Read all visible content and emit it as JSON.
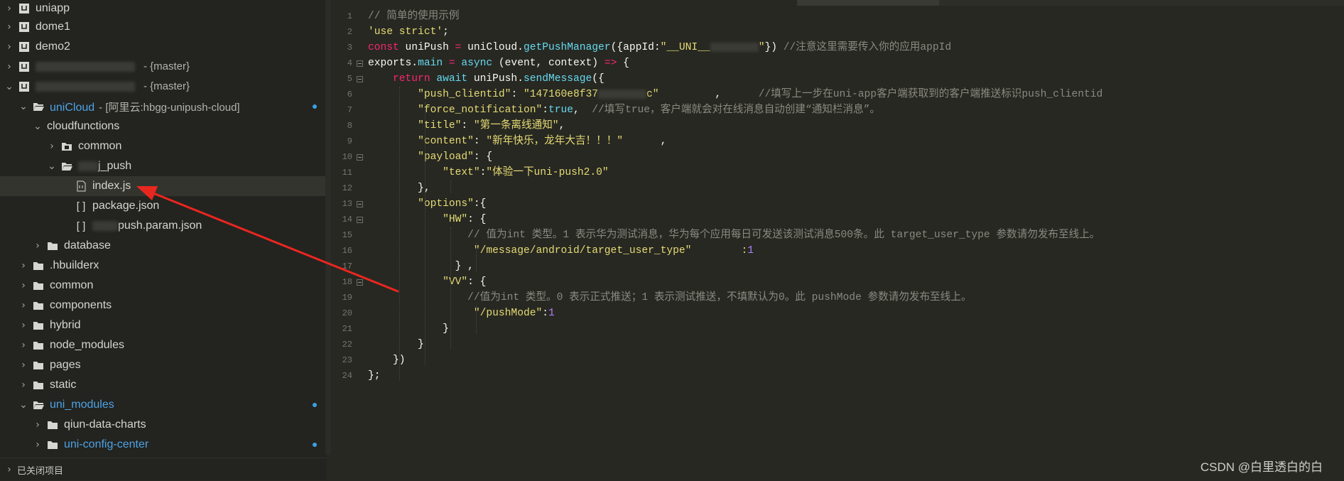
{
  "sidebar": {
    "items": [
      {
        "label": "uniapp",
        "type": "project"
      },
      {
        "label": "dome1",
        "type": "project"
      },
      {
        "label": "demo2",
        "type": "project"
      },
      {
        "label": "",
        "suffix": "- {master}",
        "type": "project"
      },
      {
        "label": "",
        "suffix": "- {master}",
        "type": "project"
      },
      {
        "label": "uniCloud",
        "suffix": "- [阿里云:hbgg-unipush-cloud]"
      },
      {
        "label": "cloudfunctions"
      },
      {
        "label": "common"
      },
      {
        "label": "j_push"
      },
      {
        "label": "index.js"
      },
      {
        "label": "package.json"
      },
      {
        "label": "push.param.json"
      },
      {
        "label": "database"
      },
      {
        "label": ".hbuilderx"
      },
      {
        "label": "common"
      },
      {
        "label": "components"
      },
      {
        "label": "hybrid"
      },
      {
        "label": "node_modules"
      },
      {
        "label": "pages"
      },
      {
        "label": "static"
      },
      {
        "label": "uni_modules"
      },
      {
        "label": "qiun-data-charts"
      },
      {
        "label": "uni-config-center"
      }
    ],
    "footer_label": "已关闭项目"
  },
  "editor": {
    "line_numbers": [
      "1",
      "2",
      "3",
      "4",
      "5",
      "6",
      "7",
      "8",
      "9",
      "10",
      "11",
      "12",
      "13",
      "14",
      "15",
      "16",
      "17",
      "18",
      "19",
      "20",
      "21",
      "22",
      "23",
      "24"
    ],
    "lines": [
      [
        [
          "cmt",
          "// 简单的使用示例"
        ]
      ],
      [
        [
          "str",
          "'use strict'"
        ],
        [
          "pl",
          ";"
        ]
      ],
      [
        [
          "kw",
          "const "
        ],
        [
          "pl",
          "uniPush "
        ],
        [
          "kw",
          "= "
        ],
        [
          "pl",
          "uniCloud."
        ],
        [
          "fn",
          "getPushManager"
        ],
        [
          "pl",
          "({appId:"
        ],
        [
          "str",
          "\"__UNI__"
        ],
        [
          "bl",
          ""
        ],
        [
          "str",
          "\""
        ],
        [
          "pl",
          "}) "
        ],
        [
          "cmt",
          "//注意这里需要传入你的应用appId"
        ]
      ],
      [
        [
          "pl",
          "exports."
        ],
        [
          "fn",
          "main "
        ],
        [
          "kw",
          "= "
        ],
        [
          "fn",
          "async "
        ],
        [
          "pl",
          "(event, context) "
        ],
        [
          "kw",
          "=> "
        ],
        [
          "pl",
          "{"
        ]
      ],
      [
        [
          "pl",
          "    "
        ],
        [
          "kw",
          "return "
        ],
        [
          "fn",
          "await "
        ],
        [
          "pl",
          "uniPush."
        ],
        [
          "fn",
          "sendMessage"
        ],
        [
          "pl",
          "({"
        ]
      ],
      [
        [
          "pl",
          "        "
        ],
        [
          "str",
          "\"push_clientid\""
        ],
        [
          "pl",
          ": "
        ],
        [
          "str",
          "\"147160e8f37"
        ],
        [
          "bl",
          ""
        ],
        [
          "str",
          "c\""
        ],
        [
          "pl",
          "         ,      "
        ],
        [
          "cmt",
          "//填写上一步在uni-app客户端获取到的客户端推送标识push_clientid"
        ]
      ],
      [
        [
          "pl",
          "        "
        ],
        [
          "str",
          "\"force_notification\""
        ],
        [
          "pl",
          ":"
        ],
        [
          "fn",
          "true"
        ],
        [
          "pl",
          ",  "
        ],
        [
          "cmt",
          "//填写true，客户端就会对在线消息自动创建“通知栏消息”。"
        ]
      ],
      [
        [
          "pl",
          "        "
        ],
        [
          "str",
          "\"title\""
        ],
        [
          "pl",
          ": "
        ],
        [
          "str",
          "\"第一条离线通知\""
        ],
        [
          "pl",
          ","
        ]
      ],
      [
        [
          "pl",
          "        "
        ],
        [
          "str",
          "\"content\""
        ],
        [
          "pl",
          ": "
        ],
        [
          "str",
          "\"新年快乐，龙年大吉！！！\""
        ],
        [
          "pl",
          "      ,"
        ]
      ],
      [
        [
          "pl",
          "        "
        ],
        [
          "str",
          "\"payload\""
        ],
        [
          "pl",
          ": {"
        ]
      ],
      [
        [
          "pl",
          "            "
        ],
        [
          "str",
          "\"text\""
        ],
        [
          "pl",
          ":"
        ],
        [
          "str",
          "\"体验一下uni-push2.0\""
        ]
      ],
      [
        [
          "pl",
          "        },"
        ]
      ],
      [
        [
          "pl",
          "        "
        ],
        [
          "str",
          "\"options\""
        ],
        [
          "pl",
          ":{"
        ]
      ],
      [
        [
          "pl",
          "            "
        ],
        [
          "str",
          "\"HW\""
        ],
        [
          "pl",
          ": {"
        ]
      ],
      [
        [
          "pl",
          "                "
        ],
        [
          "cmt",
          "// 值为int 类型。1 表示华为测试消息，华为每个应用每日可发送该测试消息500条。此 target_user_type 参数请勿发布至线上。"
        ]
      ],
      [
        [
          "pl",
          "                 "
        ],
        [
          "str",
          "\"/message/android/target_user_type\""
        ],
        [
          "pl",
          "        "
        ],
        [
          "str",
          ":"
        ],
        [
          "num",
          "1"
        ]
      ],
      [
        [
          "pl",
          "              } ,"
        ]
      ],
      [
        [
          "pl",
          "            "
        ],
        [
          "str",
          "\"VV\""
        ],
        [
          "pl",
          ": {"
        ]
      ],
      [
        [
          "pl",
          "                "
        ],
        [
          "cmt",
          "//值为int 类型。0 表示正式推送；1 表示测试推送，不填默认为0。此 pushMode 参数请勿发布至线上。"
        ]
      ],
      [
        [
          "pl",
          "                 "
        ],
        [
          "str",
          "\"/pushMode\""
        ],
        [
          "pl",
          ":"
        ],
        [
          "num",
          "1"
        ]
      ],
      [
        [
          "pl",
          "            }"
        ]
      ],
      [
        [
          "pl",
          "        }"
        ]
      ],
      [
        [
          "pl",
          "    })"
        ]
      ],
      [
        [
          "pl",
          "};"
        ]
      ]
    ]
  },
  "watermark": "CSDN @白里透白的白",
  "colors": {
    "accent": "#4da3e6",
    "arrow": "#e8271f",
    "string": "#e6db74",
    "keyword": "#f92672",
    "function": "#66d9ef",
    "comment": "#8a8a80"
  }
}
